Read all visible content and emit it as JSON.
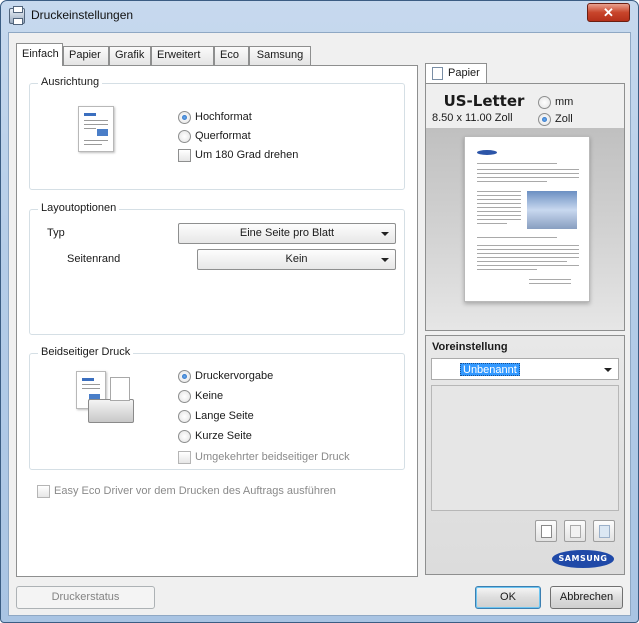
{
  "window": {
    "title": "Druckeinstellungen",
    "close_label": "✕"
  },
  "tabs": [
    {
      "label": "Einfach",
      "active": true
    },
    {
      "label": "Papier"
    },
    {
      "label": "Grafik"
    },
    {
      "label": "Erweitert"
    },
    {
      "label": "Eco"
    },
    {
      "label": "Samsung"
    }
  ],
  "orientation": {
    "legend": "Ausrichtung",
    "portrait": "Hochformat",
    "landscape": "Querformat",
    "rotate180": "Um 180 Grad drehen",
    "selected": "Hochformat"
  },
  "layout": {
    "legend": "Layoutoptionen",
    "type_label": "Typ",
    "type_value": "Eine Seite pro Blatt",
    "border_label": "Seitenrand",
    "border_value": "Kein"
  },
  "duplex": {
    "legend": "Beidseitiger Druck",
    "options": [
      "Druckervorgabe",
      "Keine",
      "Lange Seite",
      "Kurze Seite"
    ],
    "selected": "Druckervorgabe",
    "reverse": "Umgekehrter beidseitiger Druck"
  },
  "eco_driver": "Easy Eco Driver vor dem Drucken des Auftrags ausführen",
  "preview": {
    "tab_label": "Papier",
    "paper_name": "US-Letter",
    "paper_size": "8.50 x 11.00 Zoll",
    "unit_mm": "mm",
    "unit_inch": "Zoll",
    "selected_unit": "Zoll"
  },
  "preset": {
    "title": "Voreinstellung",
    "value": "Unbenannt"
  },
  "logo_text": "SAMSUNG",
  "buttons": {
    "printer_status": "Druckerstatus",
    "ok": "OK",
    "cancel": "Abbrechen"
  },
  "colors": {
    "accent": "#3399ff",
    "brand": "#1f49a8"
  }
}
